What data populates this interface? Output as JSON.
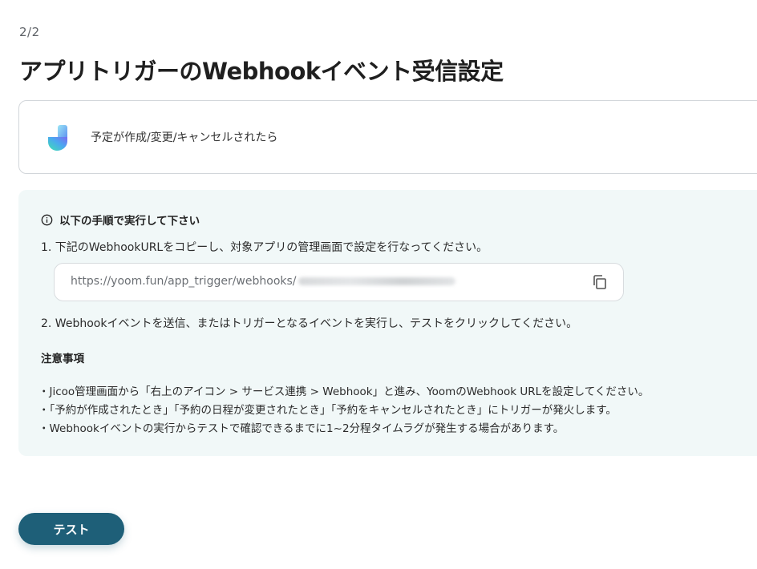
{
  "step": "2/2",
  "page_title": "アプリトリガーのWebhookイベント受信設定",
  "trigger": {
    "app_icon": "jicoo-logo",
    "label": "予定が作成/変更/キャンセルされたら"
  },
  "instructions": {
    "heading": "以下の手順で実行して下さい",
    "heading_icon": "info-icon",
    "step1": "1. 下記のWebhookURLをコピーし、対象アプリの管理画面で設定を行なってください。",
    "webhook_url": "https://yoom.fun/app_trigger/webhooks/",
    "copy_icon": "copy-icon",
    "step2": "2. Webhookイベントを送信、またはトリガーとなるイベントを実行し、テストをクリックしてください。"
  },
  "notes": {
    "heading": "注意事項",
    "items": [
      "・Jicoo管理画面から「右上のアイコン > サービス連携 > Webhook」と進み、YoomのWebhook URLを設定してください。",
      "・「予約が作成されたとき」「予約の日程が変更されたとき」「予約をキャンセルされたとき」にトリガーが発火します。",
      "・Webhookイベントの実行からテストで確認できるまでに1~2分程タイムラグが発生する場合があります。"
    ]
  },
  "test_button_label": "テスト",
  "colors": {
    "accent": "#1e5f78",
    "panel_bg": "#f1f8f8",
    "border": "#d2d6da"
  }
}
